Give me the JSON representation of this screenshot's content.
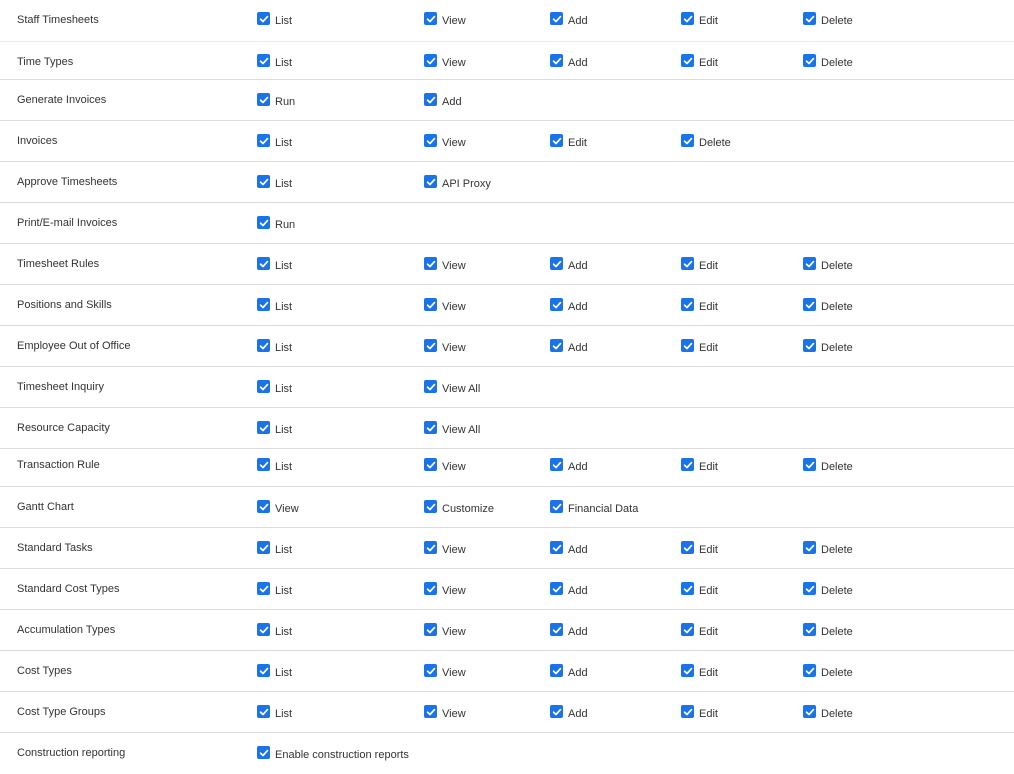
{
  "colors": {
    "checkbox": "#1a73e8",
    "text": "#333333",
    "divider": "#dcdcdc"
  },
  "icons": {
    "checkbox": "checked-checkbox-icon"
  },
  "rows": [
    {
      "label": "Staff Timesheets",
      "permissions": [
        {
          "label": "List",
          "checked": true
        },
        {
          "label": "View",
          "checked": true
        },
        {
          "label": "Add",
          "checked": true
        },
        {
          "label": "Edit",
          "checked": true
        },
        {
          "label": "Delete",
          "checked": true
        }
      ]
    },
    {
      "label": "Time Types",
      "permissions": [
        {
          "label": "List",
          "checked": true
        },
        {
          "label": "View",
          "checked": true
        },
        {
          "label": "Add",
          "checked": true
        },
        {
          "label": "Edit",
          "checked": true
        },
        {
          "label": "Delete",
          "checked": true
        }
      ]
    },
    {
      "label": "Generate Invoices",
      "permissions": [
        {
          "label": "Run",
          "checked": true
        },
        {
          "label": "Add",
          "checked": true
        }
      ]
    },
    {
      "label": "Invoices",
      "permissions": [
        {
          "label": "List",
          "checked": true
        },
        {
          "label": "View",
          "checked": true
        },
        {
          "label": "Edit",
          "checked": true
        },
        {
          "label": "Delete",
          "checked": true
        }
      ]
    },
    {
      "label": "Approve Timesheets",
      "permissions": [
        {
          "label": "List",
          "checked": true
        },
        {
          "label": "API Proxy",
          "checked": true
        }
      ]
    },
    {
      "label": "Print/E-mail Invoices",
      "permissions": [
        {
          "label": "Run",
          "checked": true
        }
      ]
    },
    {
      "label": "Timesheet Rules",
      "permissions": [
        {
          "label": "List",
          "checked": true
        },
        {
          "label": "View",
          "checked": true
        },
        {
          "label": "Add",
          "checked": true
        },
        {
          "label": "Edit",
          "checked": true
        },
        {
          "label": "Delete",
          "checked": true
        }
      ]
    },
    {
      "label": "Positions and Skills",
      "permissions": [
        {
          "label": "List",
          "checked": true
        },
        {
          "label": "View",
          "checked": true
        },
        {
          "label": "Add",
          "checked": true
        },
        {
          "label": "Edit",
          "checked": true
        },
        {
          "label": "Delete",
          "checked": true
        }
      ]
    },
    {
      "label": "Employee Out of Office",
      "permissions": [
        {
          "label": "List",
          "checked": true
        },
        {
          "label": "View",
          "checked": true
        },
        {
          "label": "Add",
          "checked": true
        },
        {
          "label": "Edit",
          "checked": true
        },
        {
          "label": "Delete",
          "checked": true
        }
      ]
    },
    {
      "label": "Timesheet Inquiry",
      "permissions": [
        {
          "label": "List",
          "checked": true
        },
        {
          "label": "View All",
          "checked": true
        }
      ]
    },
    {
      "label": "Resource Capacity",
      "permissions": [
        {
          "label": "List",
          "checked": true
        },
        {
          "label": "View All",
          "checked": true
        }
      ]
    },
    {
      "label": "Transaction Rule",
      "permissions": [
        {
          "label": "List",
          "checked": true
        },
        {
          "label": "View",
          "checked": true
        },
        {
          "label": "Add",
          "checked": true
        },
        {
          "label": "Edit",
          "checked": true
        },
        {
          "label": "Delete",
          "checked": true
        }
      ]
    },
    {
      "label": "Gantt Chart",
      "permissions": [
        {
          "label": "View",
          "checked": true
        },
        {
          "label": "Customize",
          "checked": true
        },
        {
          "label": "Financial Data",
          "checked": true
        }
      ]
    },
    {
      "label": "Standard Tasks",
      "permissions": [
        {
          "label": "List",
          "checked": true
        },
        {
          "label": "View",
          "checked": true
        },
        {
          "label": "Add",
          "checked": true
        },
        {
          "label": "Edit",
          "checked": true
        },
        {
          "label": "Delete",
          "checked": true
        }
      ]
    },
    {
      "label": "Standard Cost Types",
      "permissions": [
        {
          "label": "List",
          "checked": true
        },
        {
          "label": "View",
          "checked": true
        },
        {
          "label": "Add",
          "checked": true
        },
        {
          "label": "Edit",
          "checked": true
        },
        {
          "label": "Delete",
          "checked": true
        }
      ]
    },
    {
      "label": "Accumulation Types",
      "permissions": [
        {
          "label": "List",
          "checked": true
        },
        {
          "label": "View",
          "checked": true
        },
        {
          "label": "Add",
          "checked": true
        },
        {
          "label": "Edit",
          "checked": true
        },
        {
          "label": "Delete",
          "checked": true
        }
      ]
    },
    {
      "label": "Cost Types",
      "permissions": [
        {
          "label": "List",
          "checked": true
        },
        {
          "label": "View",
          "checked": true
        },
        {
          "label": "Add",
          "checked": true
        },
        {
          "label": "Edit",
          "checked": true
        },
        {
          "label": "Delete",
          "checked": true
        }
      ]
    },
    {
      "label": "Cost Type Groups",
      "permissions": [
        {
          "label": "List",
          "checked": true
        },
        {
          "label": "View",
          "checked": true
        },
        {
          "label": "Add",
          "checked": true
        },
        {
          "label": "Edit",
          "checked": true
        },
        {
          "label": "Delete",
          "checked": true
        }
      ]
    },
    {
      "label": "Construction reporting",
      "permissions": [
        {
          "label": "Enable construction reports",
          "checked": true
        }
      ]
    }
  ]
}
